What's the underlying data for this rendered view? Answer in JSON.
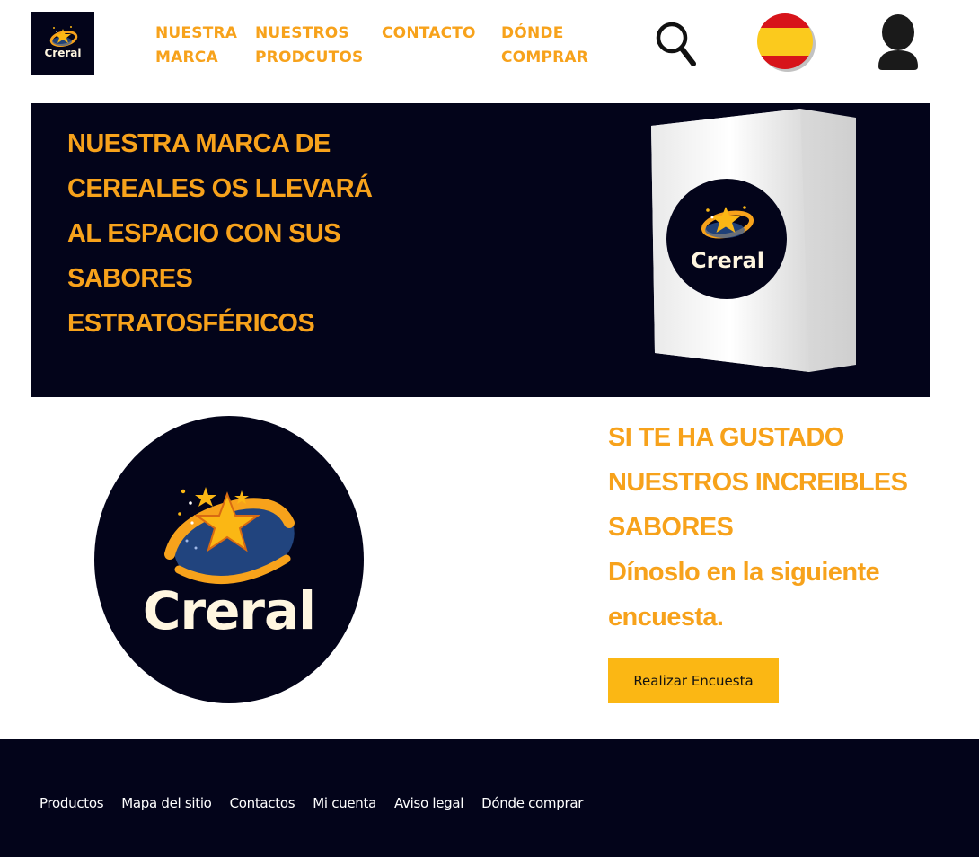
{
  "brand": {
    "logo_text": "Creral"
  },
  "nav": [
    {
      "line1": "NUESTRA",
      "line2": "MARCA"
    },
    {
      "line1": "NUESTROS",
      "line2": "PRODCUTOS"
    },
    {
      "line1": "CONTACTO",
      "line2": ""
    },
    {
      "line1": "DÓNDE",
      "line2": "COMPRAR"
    }
  ],
  "header_icons": {
    "search": "search-icon",
    "language": "spain-flag-icon",
    "account": "user-icon"
  },
  "hero": {
    "headline": "NUESTRA MARCA DE CEREALES OS LLEVARÁ AL ESPACIO CON SUS SABORES ESTRATOSFÉRICOS",
    "box_logo_text": "Creral"
  },
  "promo": {
    "line1": "SI TE HA GUSTADO",
    "line2": "NUESTROS INCREIBLES",
    "line3": "SABORES",
    "line4": "Dínoslo en la siguiente encuesta.",
    "button_label": "Realizar Encuesta"
  },
  "footer": {
    "links": [
      "Productos",
      "Mapa del sitio",
      "Contactos",
      "Mi cuenta",
      "Aviso legal",
      "Dónde comprar"
    ]
  },
  "colors": {
    "accent": "#f7a21b",
    "dark": "#03041a",
    "button": "#fbb714",
    "flag_red": "#d7141a",
    "flag_yellow": "#fbca1d"
  }
}
